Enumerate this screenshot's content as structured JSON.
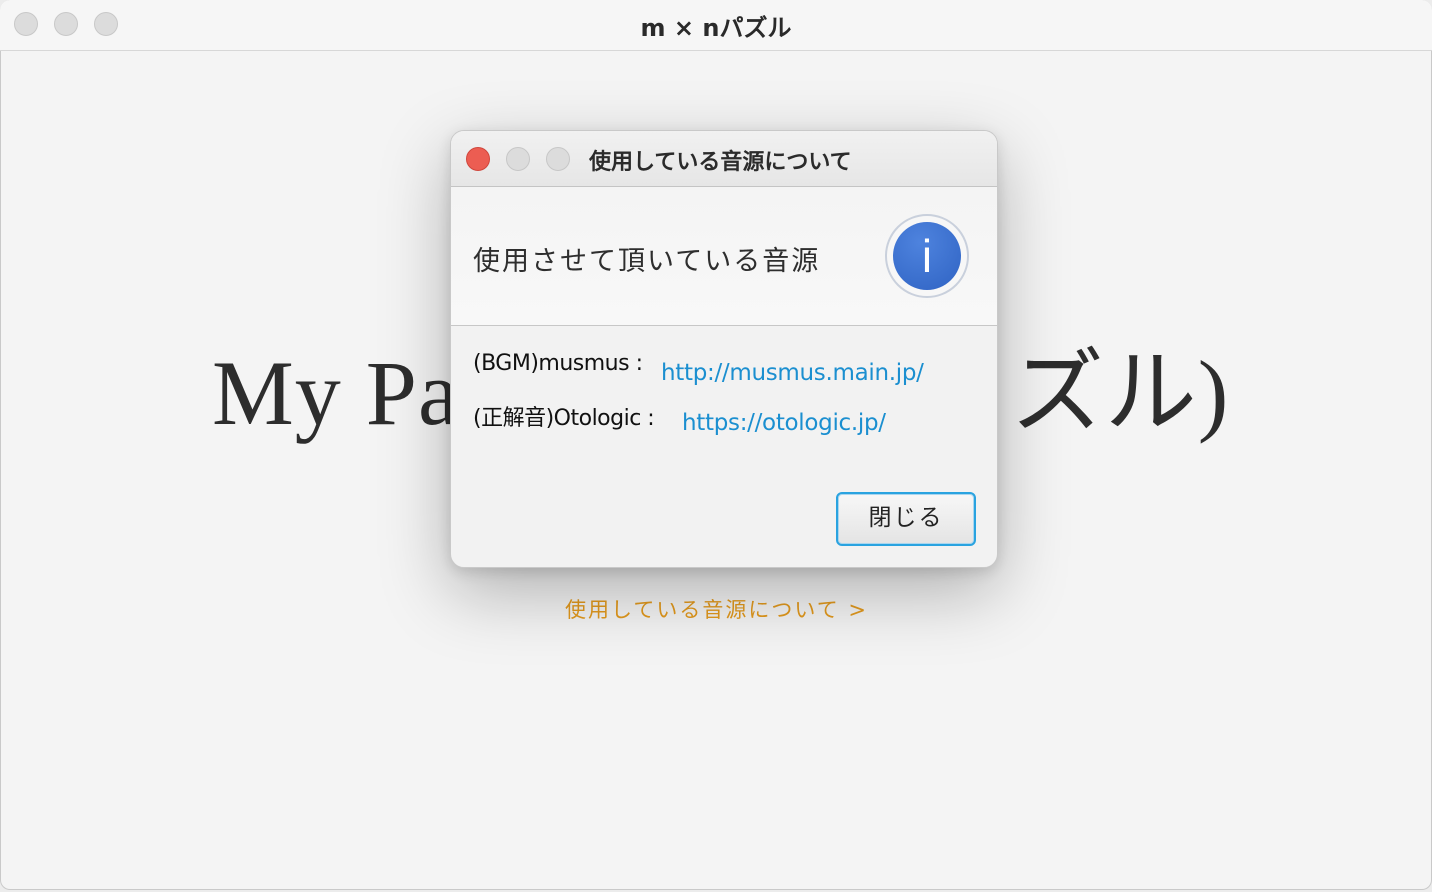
{
  "window": {
    "title": "m × nパズル"
  },
  "main": {
    "heading": "My Pa                       ズル)",
    "sound_link": "使用している音源について >"
  },
  "dialog": {
    "title": "使用している音源について",
    "header_text": "使用させて頂いている音源",
    "info_icon_glyph": "i",
    "credits": [
      {
        "label": "(BGM)musmus :",
        "link": "http://musmus.main.jp/"
      },
      {
        "label": "(正解音)Otologic :",
        "link": "https://otologic.jp/"
      }
    ],
    "close_label": "閉じる"
  },
  "colors": {
    "link_blue": "#1b8fd0",
    "link_orange": "#e39a1e",
    "close_red": "#ec5d52",
    "info_blue": "#2f63c3"
  }
}
